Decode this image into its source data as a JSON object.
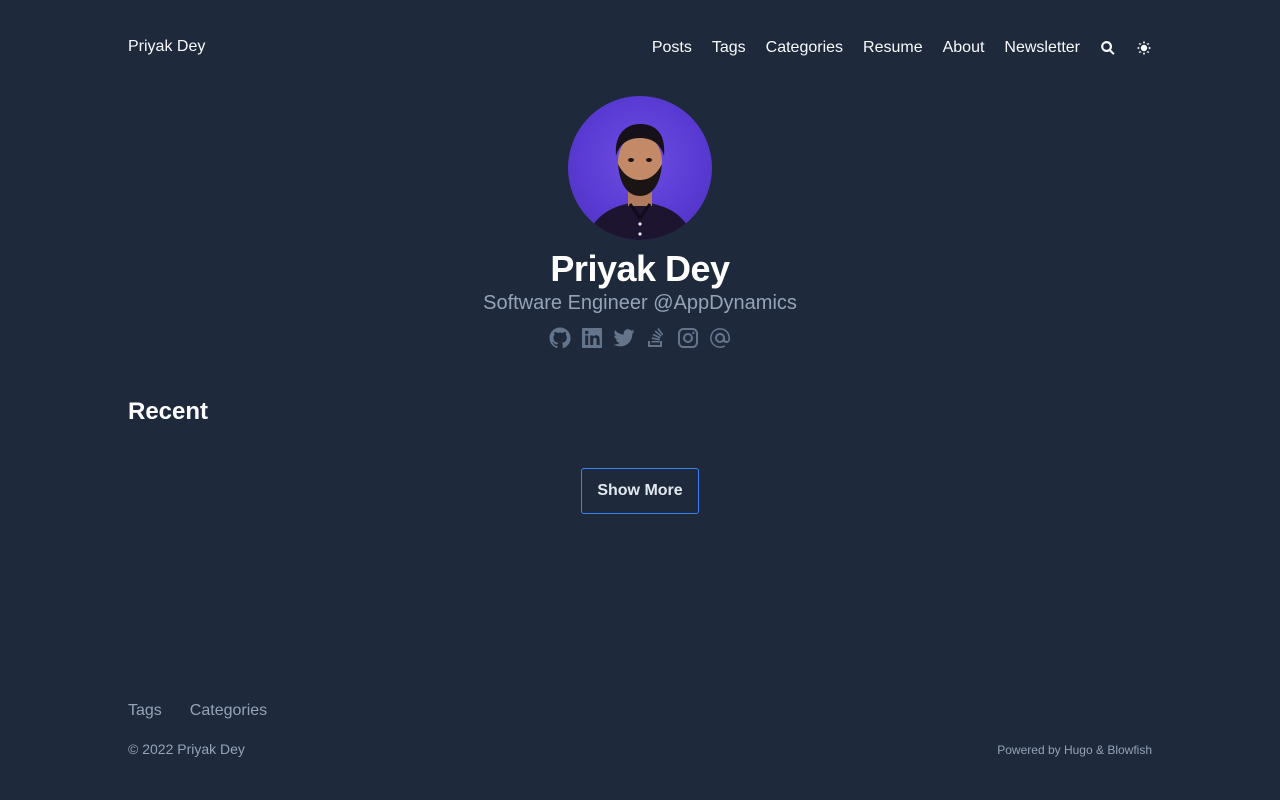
{
  "header": {
    "site_title": "Priyak Dey",
    "nav": [
      {
        "label": "Posts"
      },
      {
        "label": "Tags"
      },
      {
        "label": "Categories"
      },
      {
        "label": "Resume"
      },
      {
        "label": "About"
      },
      {
        "label": "Newsletter"
      }
    ],
    "icons": [
      "search-icon",
      "theme-toggle-icon"
    ]
  },
  "profile": {
    "name": "Priyak Dey",
    "subtitle": "Software Engineer @AppDynamics",
    "social_icons": [
      "github-icon",
      "linkedin-icon",
      "twitter-icon",
      "stackoverflow-icon",
      "instagram-icon",
      "email-icon"
    ]
  },
  "recent": {
    "heading": "Recent",
    "show_more_label": "Show More"
  },
  "footer": {
    "links": [
      {
        "label": "Tags"
      },
      {
        "label": "Categories"
      }
    ],
    "copyright": "© 2022 Priyak Dey",
    "powered_by": "Powered by Hugo & Blowfish"
  },
  "colors": {
    "background": "#1e293b",
    "accent": "#3b82f6",
    "muted_text": "#94a3b8",
    "icon": "#64748b"
  }
}
